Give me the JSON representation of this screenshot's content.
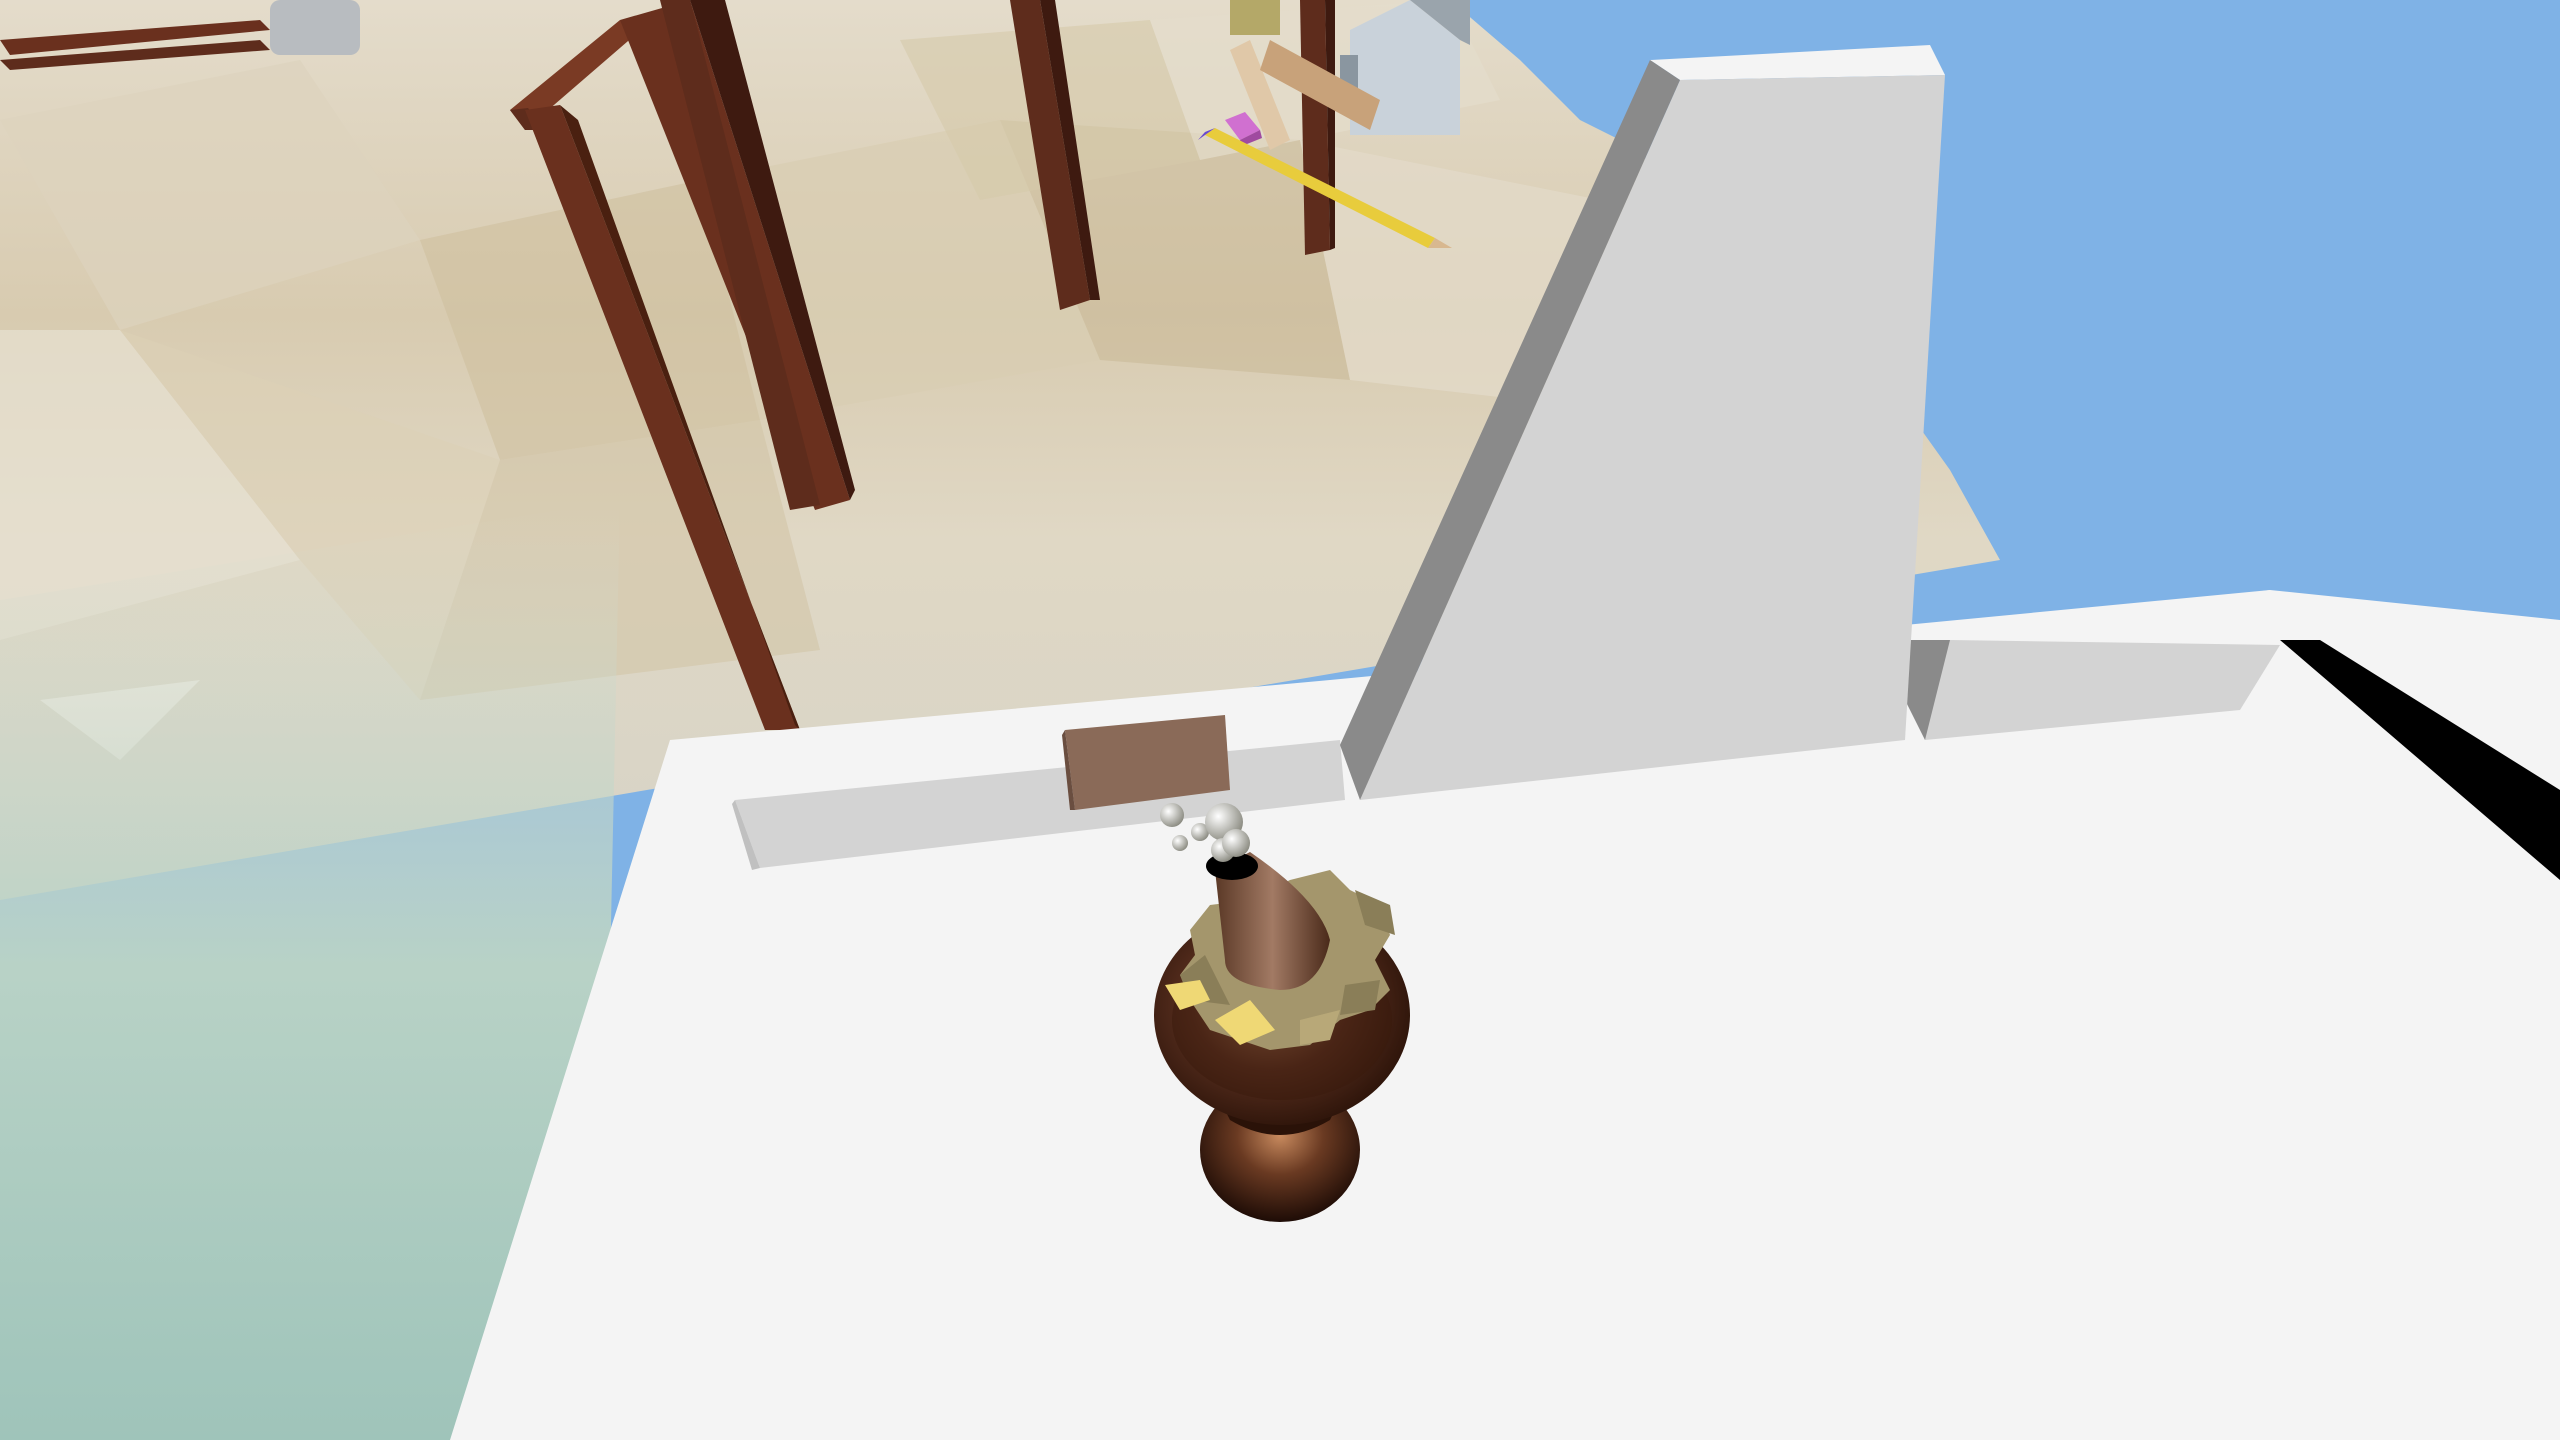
{
  "scene": {
    "sky_color": "#7fb2e6",
    "ground_light_color": "#e8e1d2",
    "ground_sand_color": "#d2c3a4",
    "water_color": "#a3c7be",
    "platform_top_color": "#f4f4f4",
    "platform_shade_color": "#d3d3d3",
    "platform_dark_color": "#8a8a8a",
    "beam_color": "#5e2c1c",
    "beam_dark_color": "#3e1a10",
    "sign_color": "#8a6a58",
    "gear_color": "#a4966c",
    "gear_highlight_color": "#efd875",
    "body_color": "#4a2a1a",
    "pencil_color": "#e8cc3c",
    "eraser_color": "#d070d0",
    "house_color": "#c9d2da"
  },
  "objects": [
    {
      "name": "wooden-frame-left",
      "kind": "prop"
    },
    {
      "name": "wooden-frame-back",
      "kind": "prop"
    },
    {
      "name": "white-ramp",
      "kind": "platform"
    },
    {
      "name": "white-ledge",
      "kind": "platform"
    },
    {
      "name": "wooden-sign",
      "kind": "prop"
    },
    {
      "name": "steam-player-character",
      "kind": "player"
    },
    {
      "name": "pencil",
      "kind": "collectible"
    },
    {
      "name": "eraser",
      "kind": "collectible"
    },
    {
      "name": "toy-house",
      "kind": "prop"
    }
  ]
}
